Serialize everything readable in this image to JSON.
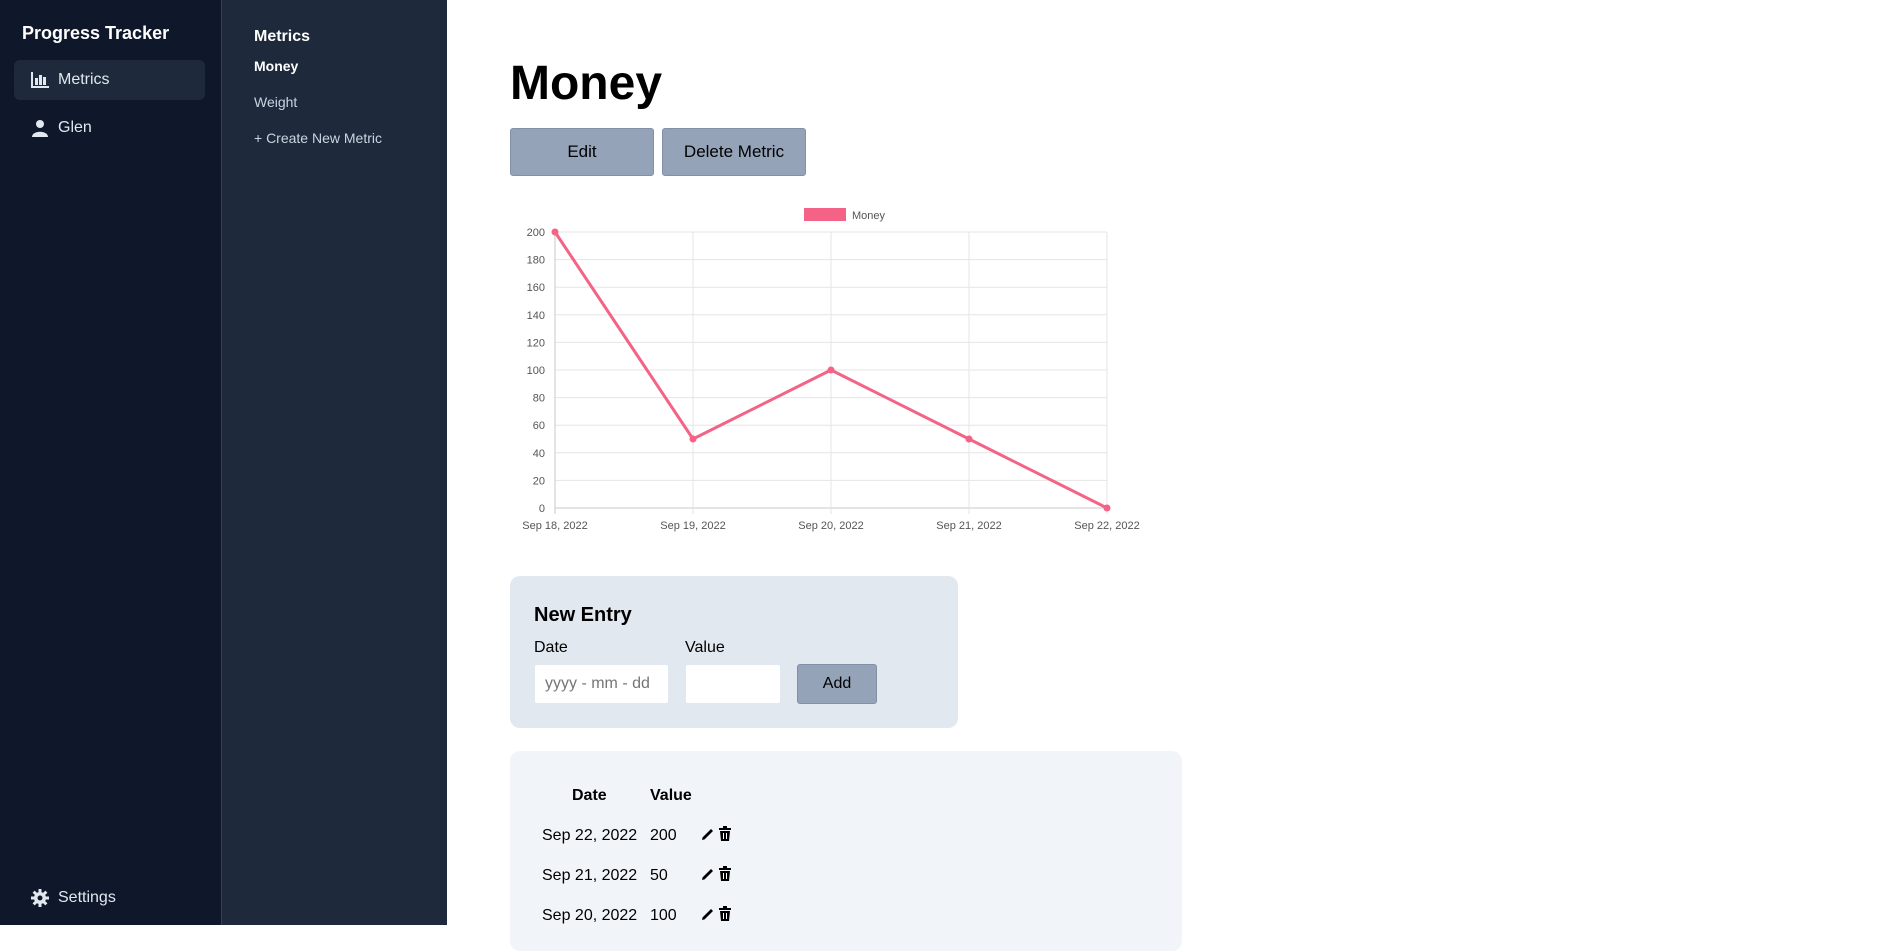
{
  "app": {
    "title": "Progress Tracker"
  },
  "sidebar": {
    "items": [
      {
        "label": "Metrics",
        "icon": "bar-chart-icon",
        "active": true
      },
      {
        "label": "Glen",
        "icon": "user-icon",
        "active": false
      }
    ],
    "settings_label": "Settings"
  },
  "metrics_nav": {
    "title": "Metrics",
    "items": [
      {
        "label": "Money",
        "active": true
      },
      {
        "label": "Weight",
        "active": false
      },
      {
        "label": "+ Create New Metric",
        "active": false
      }
    ]
  },
  "main": {
    "title": "Money",
    "edit_label": "Edit",
    "delete_label": "Delete Metric"
  },
  "chart_data": {
    "type": "line",
    "legend": "Money",
    "legend_position": "top",
    "x": [
      "Sep 18, 2022",
      "Sep 19, 2022",
      "Sep 20, 2022",
      "Sep 21, 2022",
      "Sep 22, 2022"
    ],
    "series": [
      {
        "name": "Money",
        "values": [
          200,
          50,
          100,
          50,
          0
        ]
      }
    ],
    "y_ticks": [
      "0",
      "20",
      "40",
      "60",
      "80",
      "100",
      "120",
      "140",
      "160",
      "180",
      "200"
    ],
    "ylim": [
      0,
      200
    ],
    "grid": true,
    "color": "#f46385"
  },
  "new_entry": {
    "title": "New Entry",
    "date_label": "Date",
    "value_label": "Value",
    "date_placeholder": "yyyy - mm - dd",
    "value_placeholder": "",
    "add_label": "Add"
  },
  "entries_table": {
    "headers": {
      "date": "Date",
      "value": "Value"
    },
    "rows": [
      {
        "date": "Sep 22, 2022",
        "value": "200"
      },
      {
        "date": "Sep 21, 2022",
        "value": "50"
      },
      {
        "date": "Sep 20, 2022",
        "value": "100"
      }
    ]
  }
}
